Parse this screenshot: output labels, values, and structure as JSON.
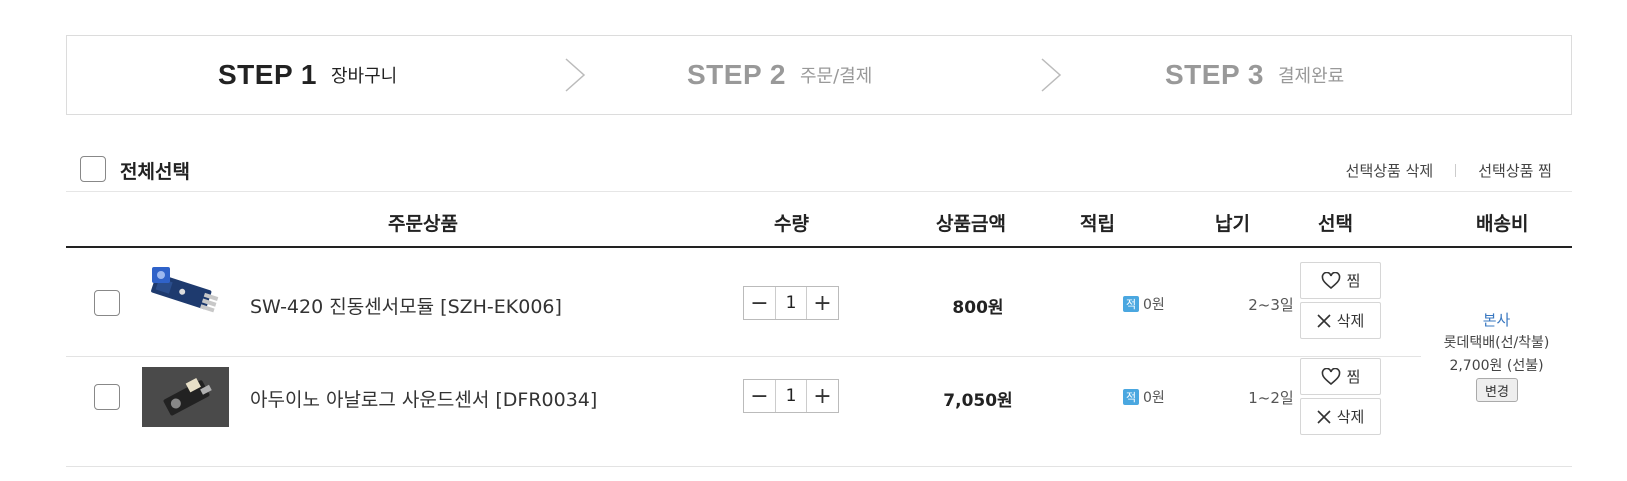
{
  "steps": [
    {
      "num": "STEP 1",
      "name": "장바구니",
      "state": "active"
    },
    {
      "num": "STEP 2",
      "name": "주문/결제",
      "state": "inactive"
    },
    {
      "num": "STEP 3",
      "name": "결제완료",
      "state": "inactive"
    }
  ],
  "select_bar": {
    "select_all_label": "전체선택",
    "delete_selected_label": "선택상품 삭제",
    "wish_selected_label": "선택상품 찜"
  },
  "table": {
    "headers": {
      "product": "주문상품",
      "quantity": "수량",
      "amount": "상품금액",
      "points": "적립",
      "delivery_time": "납기",
      "select": "선택",
      "shipping": "배송비"
    },
    "rows": [
      {
        "name": "SW-420 진동센서모듈 [SZH-EK006]",
        "thumb_icon": "vibration-sensor-module-image",
        "quantity": "1",
        "amount": "800원",
        "point_badge": "적",
        "points": "0원",
        "delivery_time": "2~3일",
        "wish_label": "찜",
        "delete_label": "삭제"
      },
      {
        "name": "아두이노 아날로그 사운드센서 [DFR0034]",
        "thumb_icon": "sound-sensor-module-image",
        "quantity": "1",
        "amount": "7,050원",
        "point_badge": "적",
        "points": "0원",
        "delivery_time": "1~2일",
        "wish_label": "찜",
        "delete_label": "삭제"
      }
    ],
    "shipping": {
      "company": "본사",
      "method": "롯데택배(선/착불)",
      "fee": "2,700원 (선불)",
      "change_label": "변경"
    }
  },
  "colors": {
    "link_blue": "#3a78c0",
    "point_badge": "#4aa7e0",
    "inactive_step": "#999999"
  }
}
